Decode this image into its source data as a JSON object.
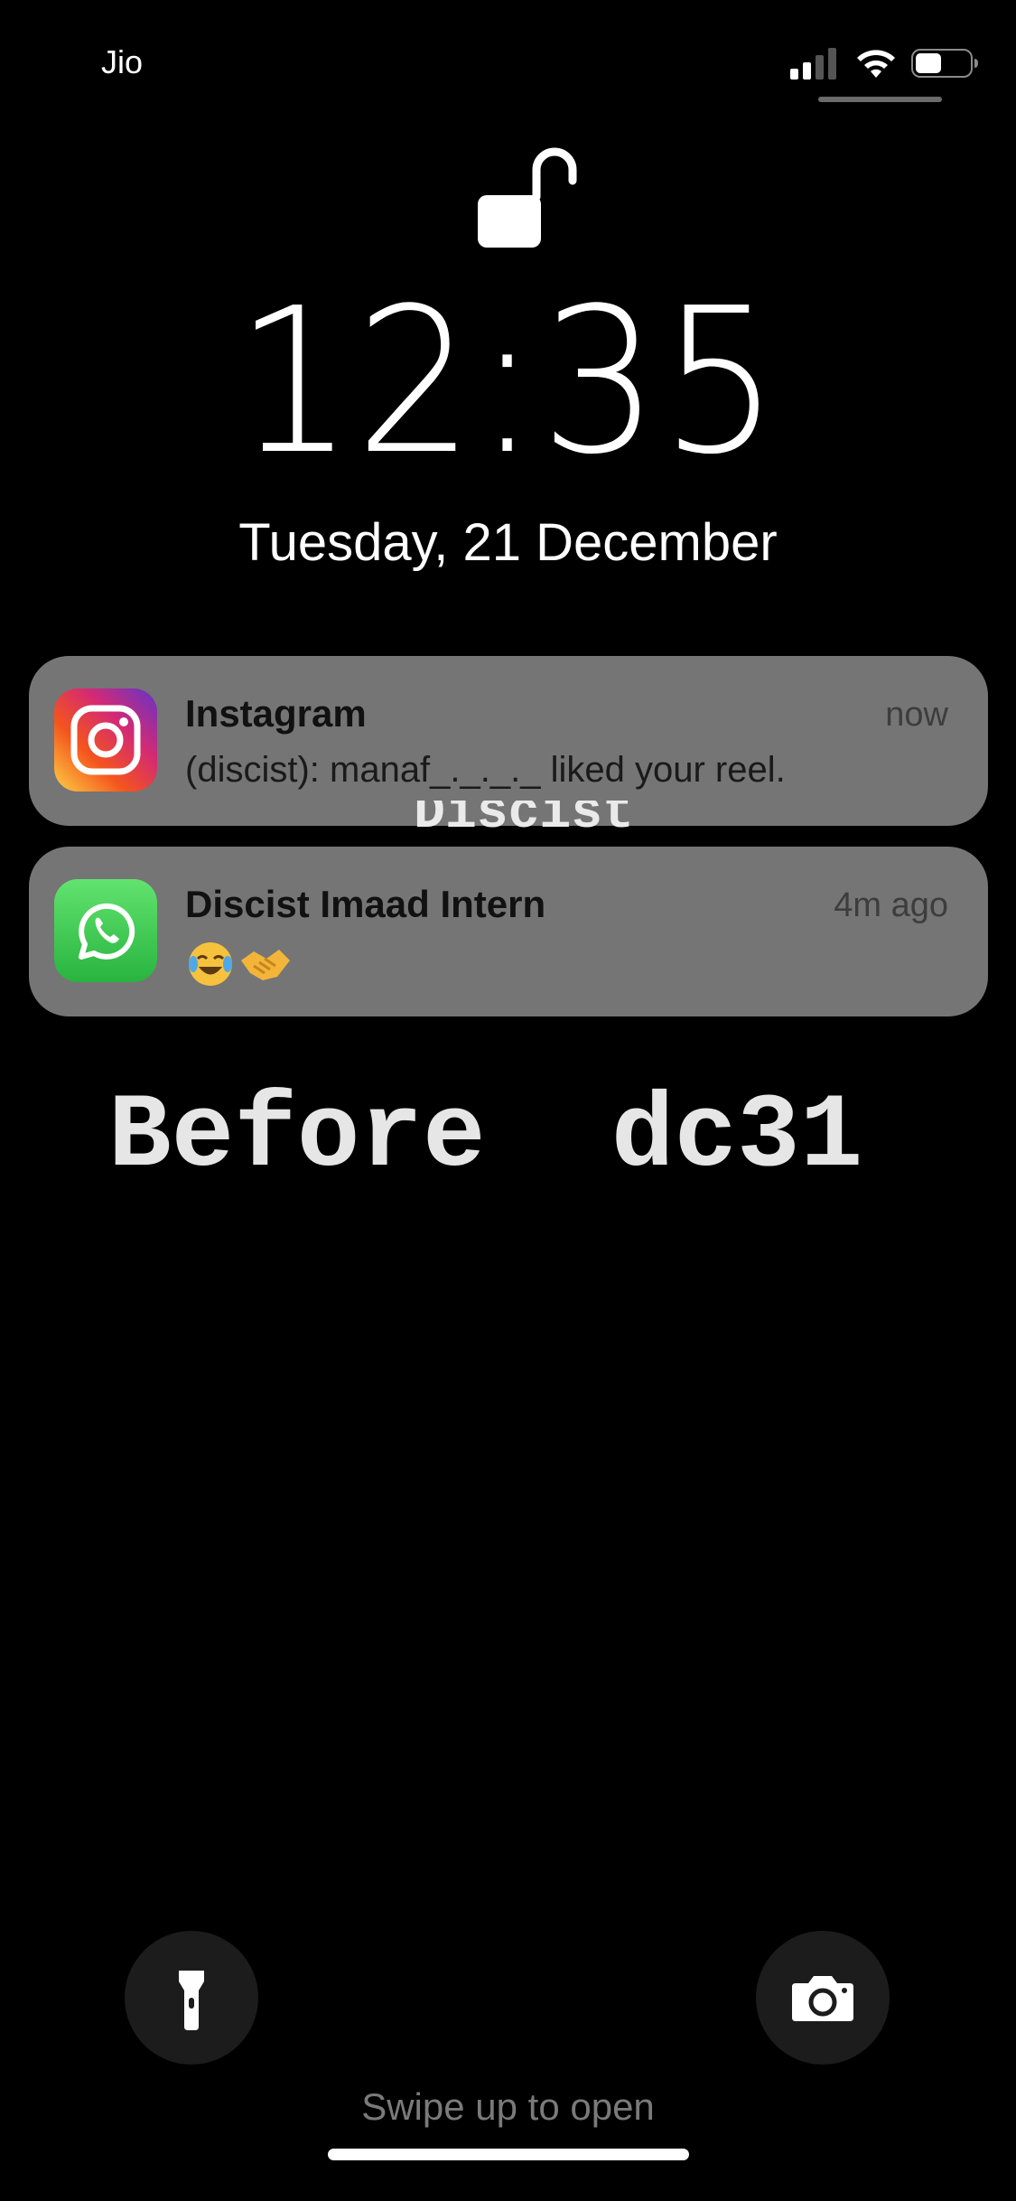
{
  "status_bar": {
    "carrier": "Jio",
    "battery_level": 0.45
  },
  "lock_screen": {
    "time": "12:35",
    "date": "Tuesday, 21 December"
  },
  "notifications": [
    {
      "app": "Instagram",
      "icon": "instagram-icon",
      "title": "Instagram",
      "time": "now",
      "body": "(discist): manaf_._._._ liked your reel."
    },
    {
      "app": "WhatsApp",
      "icon": "whatsapp-icon",
      "title": "Discist Imaad Intern",
      "time": "4m ago",
      "body": "😂🤝"
    }
  ],
  "overlay": {
    "small_text": "Discist",
    "large_text": "Before  dc31"
  },
  "bottom": {
    "flashlight": "flashlight-icon",
    "camera": "camera-icon",
    "swipe_text": "Swipe up to open"
  },
  "colors": {
    "background": "#000000",
    "notification_bg": "#757575",
    "button_bg": "#1c1c1c"
  }
}
